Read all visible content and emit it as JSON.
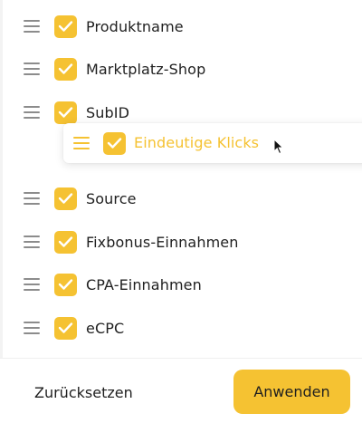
{
  "colors": {
    "accent": "#f5c232",
    "text": "#1f1f1f",
    "handle": "#8c8c8c"
  },
  "columns": [
    {
      "label": "Produktname",
      "checked": true
    },
    {
      "label": "Marktplatz-Shop",
      "checked": true
    },
    {
      "label": "SubID",
      "checked": true
    },
    {
      "label": "Source",
      "checked": true
    },
    {
      "label": "Fixbonus-Einnahmen",
      "checked": true
    },
    {
      "label": "CPA-Einnahmen",
      "checked": true
    },
    {
      "label": "eCPC",
      "checked": true
    }
  ],
  "dragging_item": {
    "label": "Eindeutige Klicks",
    "checked": true
  },
  "icons": {
    "handle": "drag-handle-icon",
    "checkbox": "checkmark-icon",
    "cursor": "mouse-pointer-icon"
  },
  "footer": {
    "reset_label": "Zurücksetzen",
    "apply_label": "Anwenden"
  }
}
